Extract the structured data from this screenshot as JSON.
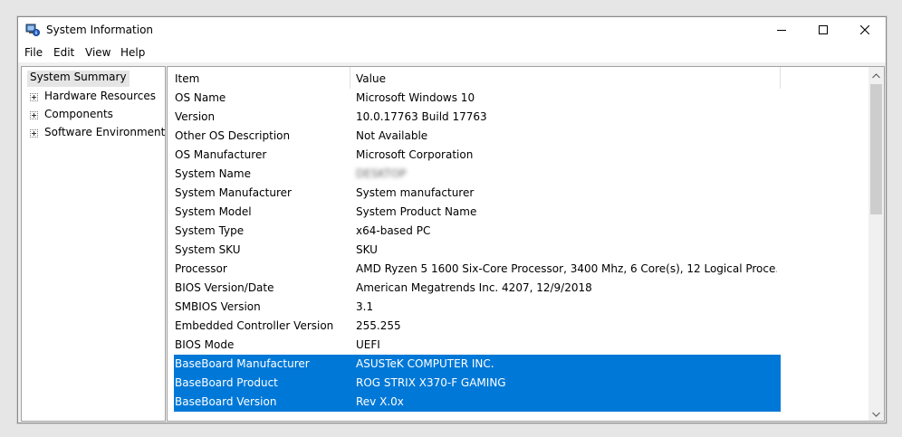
{
  "window": {
    "title": "System Information",
    "controls": {
      "minimize": "minimize",
      "maximize": "maximize",
      "close": "close"
    }
  },
  "menu": {
    "items": [
      "File",
      "Edit",
      "View",
      "Help"
    ]
  },
  "tree": {
    "root": "System Summary",
    "children": [
      "Hardware Resources",
      "Components",
      "Software Environment"
    ]
  },
  "list": {
    "columns": [
      "Item",
      "Value"
    ],
    "rows": [
      {
        "item": "OS Name",
        "value": "Microsoft Windows 10"
      },
      {
        "item": "Version",
        "value": "10.0.17763 Build 17763"
      },
      {
        "item": "Other OS Description",
        "value": "Not Available"
      },
      {
        "item": "OS Manufacturer",
        "value": "Microsoft Corporation"
      },
      {
        "item": "System Name",
        "value": "DESKTOP"
      },
      {
        "item": "System Manufacturer",
        "value": "System manufacturer"
      },
      {
        "item": "System Model",
        "value": "System Product Name"
      },
      {
        "item": "System Type",
        "value": "x64-based PC"
      },
      {
        "item": "System SKU",
        "value": "SKU"
      },
      {
        "item": "Processor",
        "value": "AMD Ryzen 5 1600 Six-Core Processor, 3400 Mhz, 6 Core(s), 12 Logical Proce..."
      },
      {
        "item": "BIOS Version/Date",
        "value": "American Megatrends Inc. 4207, 12/9/2018"
      },
      {
        "item": "SMBIOS Version",
        "value": "3.1"
      },
      {
        "item": "Embedded Controller Version",
        "value": "255.255"
      },
      {
        "item": "BIOS Mode",
        "value": "UEFI"
      },
      {
        "item": "BaseBoard Manufacturer",
        "value": "ASUSTeK COMPUTER INC."
      },
      {
        "item": "BaseBoard Product",
        "value": "ROG STRIX X370-F GAMING"
      },
      {
        "item": "BaseBoard Version",
        "value": "Rev X.0x"
      }
    ]
  },
  "colors": {
    "selection": "#0078d7",
    "window_bg": "#f0f0f0"
  }
}
